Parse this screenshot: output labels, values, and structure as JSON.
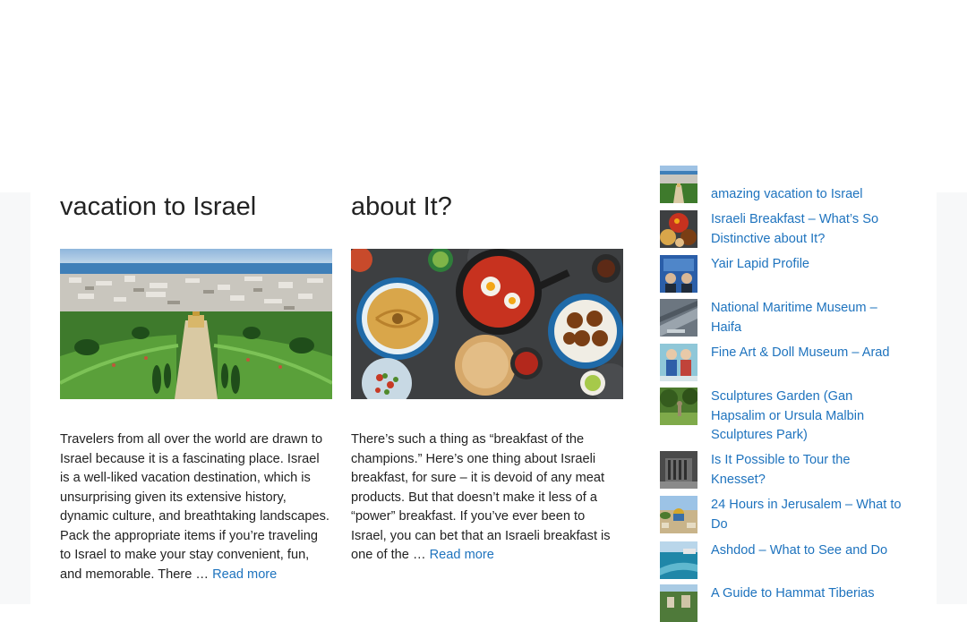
{
  "posts": [
    {
      "title": "vacation to Israel",
      "image_icon": "haifa-bahai-gardens-photo",
      "excerpt": "Travelers from all over the world are drawn to Israel because it is a fascinating place. Israel is a well-liked vacation destination, which is unsurprising given its extensive history, dynamic culture, and breathtaking landscapes. Pack the appropriate items if you’re traveling to Israel to make your stay convenient, fun, and memorable. There …",
      "read_more": "Read more"
    },
    {
      "title": "about It?",
      "image_icon": "israeli-breakfast-spread-photo",
      "excerpt": "There’s such a thing as “breakfast of the champions.” Here’s one thing about Israeli breakfast, for sure – it is devoid of any meat products. But that doesn’t make it less of a “power” breakfast.  If you’ve ever been to Israel, you can bet that an Israeli breakfast is one of the …",
      "read_more": "Read more"
    }
  ],
  "sidebar": {
    "items": [
      {
        "label": "amazing vacation to Israel",
        "thumb_icon": "haifa-thumb"
      },
      {
        "label": "Israeli Breakfast – What’s So Distinctive about It?",
        "thumb_icon": "breakfast-thumb"
      },
      {
        "label": "Yair Lapid Profile",
        "thumb_icon": "lapid-thumb"
      },
      {
        "label": "National Maritime Museum – Haifa",
        "thumb_icon": "maritime-museum-thumb"
      },
      {
        "label": "Fine Art & Doll Museum – Arad",
        "thumb_icon": "doll-museum-thumb"
      },
      {
        "label": "Sculptures Garden (Gan Hapsalim or Ursula Malbin Sculptures Park)",
        "thumb_icon": "sculpture-garden-thumb"
      },
      {
        "label": "Is It Possible to Tour the Knesset?",
        "thumb_icon": "knesset-thumb"
      },
      {
        "label": "24 Hours in Jerusalem – What to Do",
        "thumb_icon": "jerusalem-thumb"
      },
      {
        "label": "Ashdod – What to See and Do",
        "thumb_icon": "ashdod-thumb"
      },
      {
        "label": "A Guide to Hammat Tiberias",
        "thumb_icon": "tiberias-thumb"
      }
    ]
  },
  "colors": {
    "link": "#1e73be",
    "text": "#222222",
    "page_background": "#f7f8f9",
    "card_background": "#ffffff"
  }
}
